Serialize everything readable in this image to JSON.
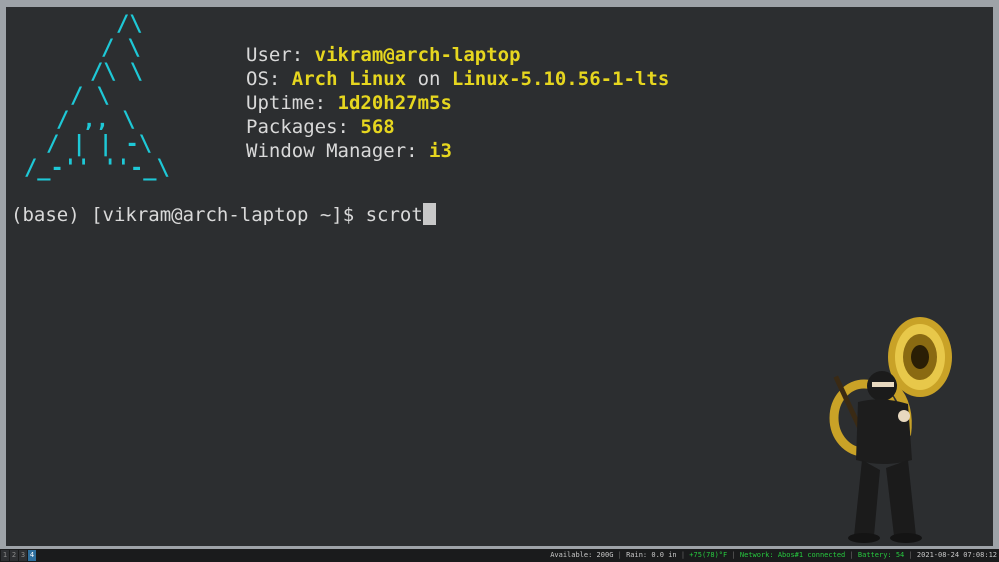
{
  "terminal": {
    "info": {
      "user_label": "User: ",
      "user_value": "vikram@arch-laptop",
      "os_label": "OS: ",
      "os_value1": "Arch Linux",
      "os_on": " on ",
      "os_value2": "Linux-5.10.56-1-lts",
      "uptime_label": "Uptime: ",
      "uptime_value": "1d20h27m5s",
      "packages_label": "Packages: ",
      "packages_value": "568",
      "wm_label": "Window Manager: ",
      "wm_value": "i3"
    },
    "prompt": "(base) [vikram@arch-laptop ~]$ ",
    "command": "scrot"
  },
  "statusbar": {
    "workspaces": [
      "1",
      "2",
      "3",
      "4"
    ],
    "active_workspace": "4",
    "disk": "Available: 200G",
    "rain": "Rain: 0.0 in",
    "temp": "+75(78)°F",
    "network": "Network: Abos#1 connected",
    "battery": "Battery: 54",
    "datetime": "2021-08-24 07:08:12"
  },
  "colors": {
    "terminal_bg": "#2c2e30",
    "logo_cyan": "#1ec8d6",
    "info_value": "#e6d61f",
    "active_workspace": "#2e6f9e",
    "status_green": "#27c93f"
  },
  "icons": {
    "logo": "arch-linux-ascii-logo",
    "wallpaper": "ninja-tuba-mascot"
  }
}
